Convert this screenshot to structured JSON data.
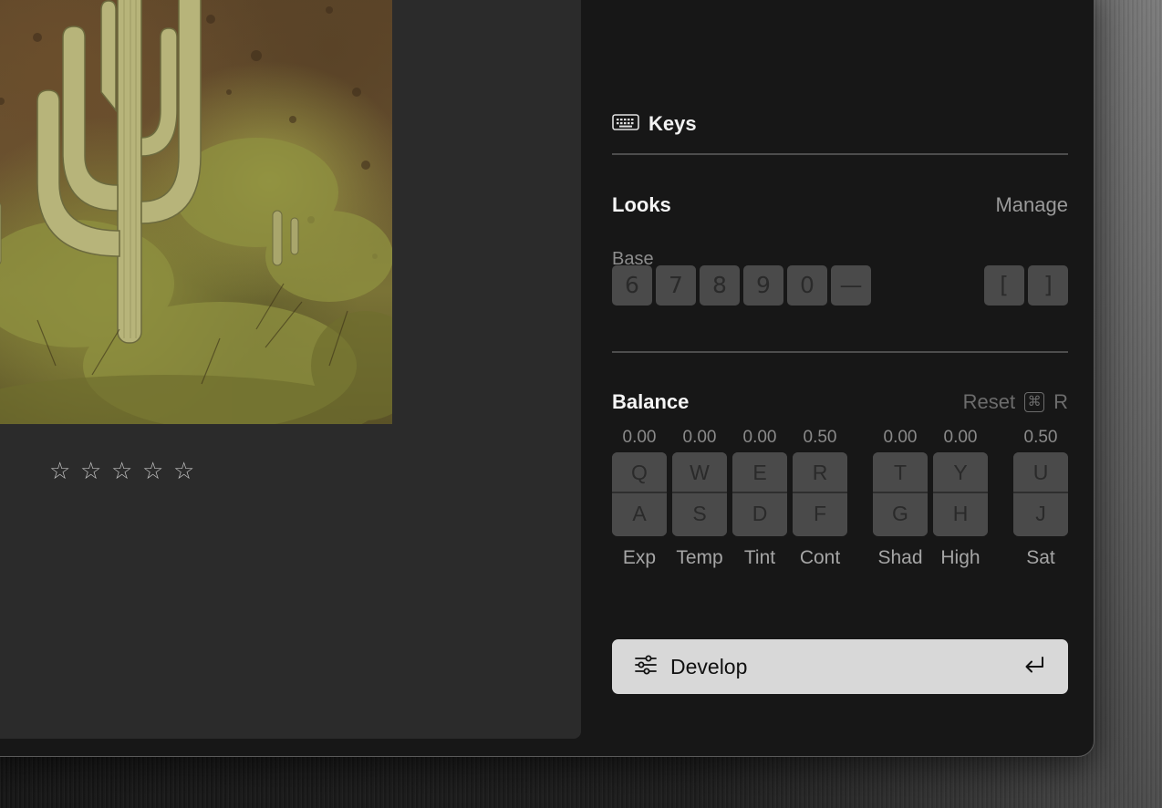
{
  "rating": {
    "stars": [
      "☆",
      "☆",
      "☆",
      "☆",
      "☆"
    ]
  },
  "keys": {
    "label": "Keys",
    "icon": "keyboard-icon"
  },
  "looks": {
    "title": "Looks",
    "manage_label": "Manage",
    "base_label": "Base",
    "base_keys": [
      "6",
      "7",
      "8",
      "9",
      "0",
      "—"
    ],
    "bracket_keys": [
      "[",
      "]"
    ]
  },
  "balance": {
    "title": "Balance",
    "reset_label": "Reset",
    "reset_cmd_symbol": "⌘",
    "reset_key": "R",
    "sliders": [
      {
        "value": "0.00",
        "up": "Q",
        "down": "A",
        "label": "Exp"
      },
      {
        "value": "0.00",
        "up": "W",
        "down": "S",
        "label": "Temp"
      },
      {
        "value": "0.00",
        "up": "E",
        "down": "D",
        "label": "Tint"
      },
      {
        "value": "0.50",
        "up": "R",
        "down": "F",
        "label": "Cont"
      },
      {
        "value": "0.00",
        "up": "T",
        "down": "G",
        "label": "Shad"
      },
      {
        "value": "0.00",
        "up": "Y",
        "down": "H",
        "label": "High"
      },
      {
        "value": "0.50",
        "up": "U",
        "down": "J",
        "label": "Sat"
      }
    ]
  },
  "develop": {
    "label": "Develop",
    "icon": "sliders-icon",
    "shortcut_icon": "return-icon"
  },
  "colors": {
    "panel_bg": "#171717",
    "viewer_bg": "#2b2b2b",
    "key_bg": "#4a4a4a",
    "develop_bg": "#d8d8d8"
  }
}
